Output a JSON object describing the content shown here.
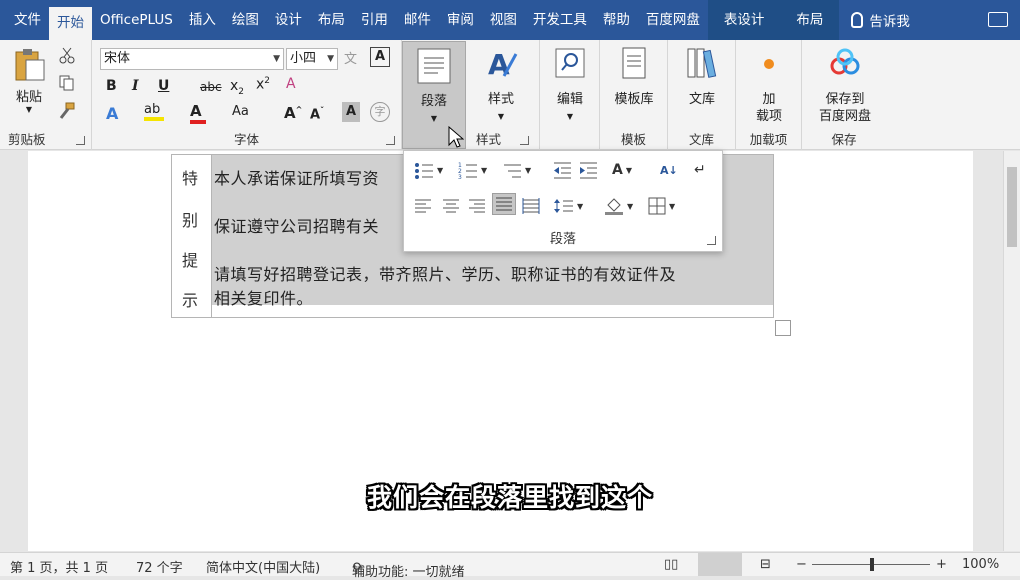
{
  "tabs": [
    "文件",
    "开始",
    "OfficePLUS",
    "插入",
    "绘图",
    "设计",
    "布局",
    "引用",
    "邮件",
    "审阅",
    "视图",
    "开发工具",
    "帮助",
    "百度网盘",
    "表设计",
    "布局"
  ],
  "tell_me": "告诉我",
  "ribbon": {
    "clipboard": {
      "paste": "粘贴",
      "label": "剪贴板"
    },
    "font": {
      "name": "宋体",
      "size": "小四",
      "label": "字体"
    },
    "paragraph": {
      "label": "段落"
    },
    "styles": {
      "button": "样式",
      "label": "样式"
    },
    "editing": {
      "button": "编辑"
    },
    "template": {
      "button": "模板库",
      "label": "模板"
    },
    "library": {
      "button": "文库",
      "label": "文库"
    },
    "addins": {
      "line1": "加",
      "line2": "载项",
      "label": "加载项"
    },
    "save": {
      "line1": "保存到",
      "line2": "百度网盘",
      "label": "保存"
    }
  },
  "document": {
    "side_chars": [
      "特",
      "别",
      "提",
      "示"
    ],
    "lines": [
      "本人承诺保证所填写资",
      "保证遵守公司招聘有关",
      "请填写好招聘登记表，带齐照片、学历、职称证书的有效证件及",
      "相关复印件。"
    ]
  },
  "popup": {
    "label": "段落"
  },
  "subtitle": "我们会在段落里找到这个",
  "status": {
    "page": "第 1 页，共 1 页",
    "words": "72 个字",
    "lang": "简体中文(中国大陆)",
    "access": "辅助功能: 一切就绪",
    "zoom_minus": "−",
    "zoom_plus": "+",
    "zoom": "100%"
  },
  "colors": {
    "accent": "#2b579a",
    "font_color_red": "#e02020",
    "highlight_yellow": "#f5e400"
  }
}
